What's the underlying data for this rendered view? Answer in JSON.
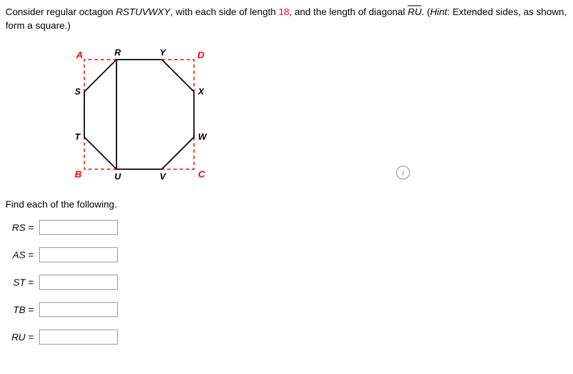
{
  "problem": {
    "prefix": "Consider regular octagon ",
    "shape": "RSTUVWXY",
    "mid1": ", with each side of length ",
    "side_length": "18",
    "mid2": ", and the length of diagonal ",
    "diagonal_label": "RU",
    "suffix": ". (",
    "hint_label": "Hint",
    "hint_text": ": Extended sides, as shown, form a square.)"
  },
  "figure": {
    "labels": {
      "A": "A",
      "R": "R",
      "Y": "Y",
      "D": "D",
      "S": "S",
      "X": "X",
      "T": "T",
      "W": "W",
      "B": "B",
      "U": "U",
      "V": "V",
      "C": "C"
    }
  },
  "find_text": "Find each of the following.",
  "answers": [
    {
      "label": "RS = ",
      "value": ""
    },
    {
      "label": "AS = ",
      "value": ""
    },
    {
      "label": "ST = ",
      "value": ""
    },
    {
      "label": "TB = ",
      "value": ""
    },
    {
      "label": "RU = ",
      "value": ""
    }
  ],
  "info_icon": "i",
  "chart_data": {
    "type": "diagram",
    "shape": "regular-octagon-in-square",
    "side_length": 18,
    "square_corners": [
      "A",
      "B",
      "C",
      "D"
    ],
    "octagon_vertices": [
      "R",
      "S",
      "T",
      "U",
      "V",
      "W",
      "X",
      "Y"
    ],
    "highlighted_diagonal": [
      "R",
      "U"
    ],
    "title": "",
    "xlabel": "",
    "ylabel": ""
  }
}
